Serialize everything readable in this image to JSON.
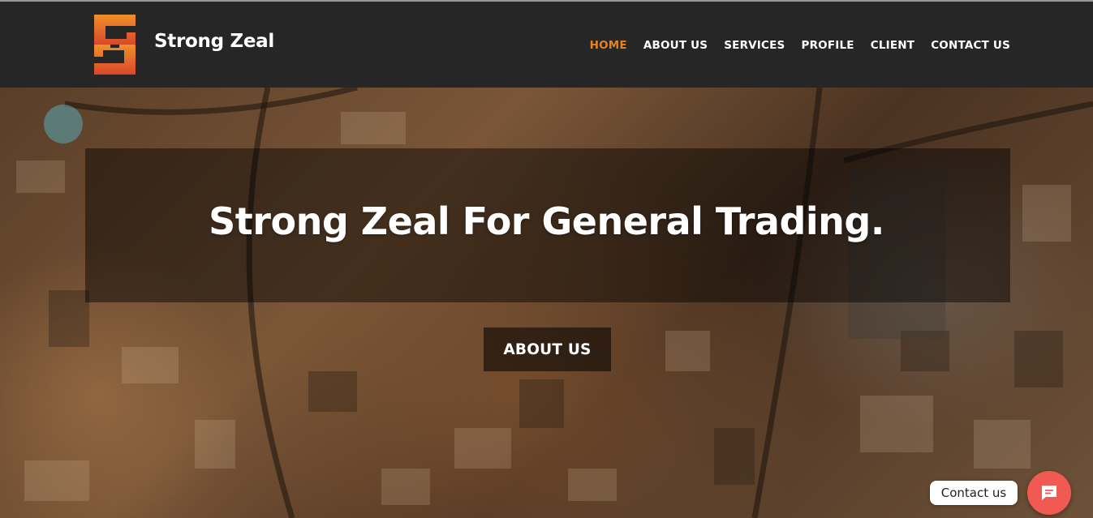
{
  "brand": {
    "name": "Strong Zeal"
  },
  "nav": {
    "items": [
      {
        "label": "HOME",
        "active": true
      },
      {
        "label": "ABOUT US"
      },
      {
        "label": "SERVICES"
      },
      {
        "label": "PROFILE"
      },
      {
        "label": "CLIENT"
      },
      {
        "label": "CONTACT US"
      }
    ]
  },
  "hero": {
    "title": "Strong Zeal For General Trading.",
    "button_label": "ABOUT US"
  },
  "contact_widget": {
    "label": "Contact us",
    "icon": "chat-icon"
  },
  "colors": {
    "accent": "#e8821e",
    "header_bg": "#262626",
    "chat": "#f05a52"
  }
}
